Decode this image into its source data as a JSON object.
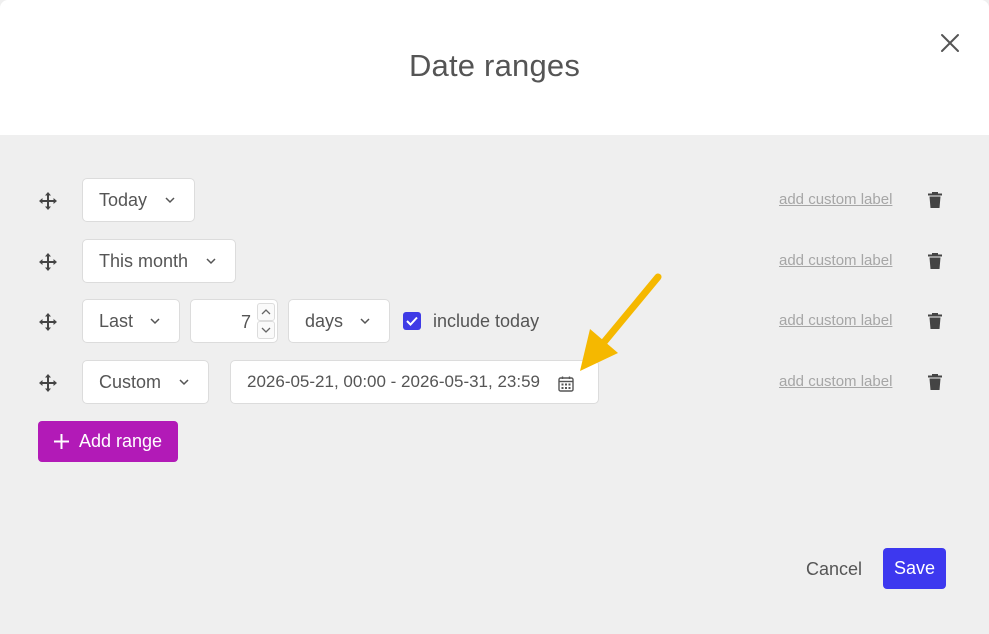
{
  "dialog": {
    "title": "Date ranges",
    "close_icon": "close-icon"
  },
  "ranges": [
    {
      "type": "Today",
      "custom_label_link": "add custom label"
    },
    {
      "type": "This month",
      "custom_label_link": "add custom label"
    },
    {
      "type": "Last",
      "amount": "7",
      "unit": "days",
      "include_today_checked": true,
      "include_today_label": "include today",
      "custom_label_link": "add custom label"
    },
    {
      "type": "Custom",
      "date_range": "2026-05-21, 00:00 - 2026-05-31, 23:59",
      "custom_label_link": "add custom label"
    }
  ],
  "add_range": {
    "label": "Add range"
  },
  "footer": {
    "cancel_label": "Cancel",
    "save_label": "Save"
  },
  "colors": {
    "accent_save": "#3d38ef",
    "accent_add": "#b21ab7",
    "checkbox": "#3f3be6",
    "annotation_arrow": "#f5b800",
    "background": "#efefef"
  },
  "icons": {
    "drag": "move-icon",
    "chevron": "chevron-down-icon",
    "trash": "trash-icon",
    "calendar": "calendar-icon",
    "plus": "plus-icon"
  }
}
